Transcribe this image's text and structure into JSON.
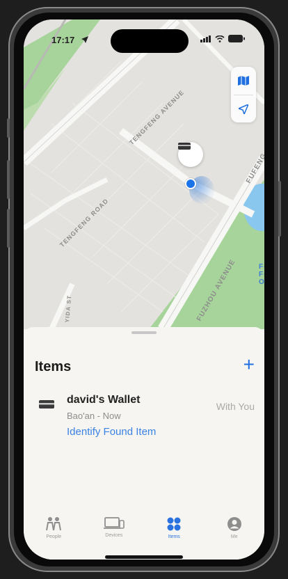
{
  "status_bar": {
    "time": "17:17"
  },
  "map": {
    "roads": [
      "TENGFENG AVENUE",
      "TENGFENG ROAD",
      "FUZHOU AVENUE",
      "FUFENG",
      "YIDA ST"
    ],
    "poi_text": "Fe\nFo\nO Ti\n"
  },
  "sheet": {
    "title": "Items",
    "add_label": "+",
    "item": {
      "name": "david's Wallet",
      "subtitle": "Bao'an - Now",
      "status": "With You"
    },
    "identify_label": "Identify Found Item"
  },
  "tabs": [
    {
      "label": "People",
      "icon": "people-icon",
      "active": false
    },
    {
      "label": "Devices",
      "icon": "devices-icon",
      "active": false
    },
    {
      "label": "Items",
      "icon": "items-icon",
      "active": true
    },
    {
      "label": "Me",
      "icon": "me-icon",
      "active": false
    }
  ],
  "colors": {
    "accent": "#1f6fe0",
    "map_green": "#a6d49a",
    "water": "#8ac7ef"
  }
}
